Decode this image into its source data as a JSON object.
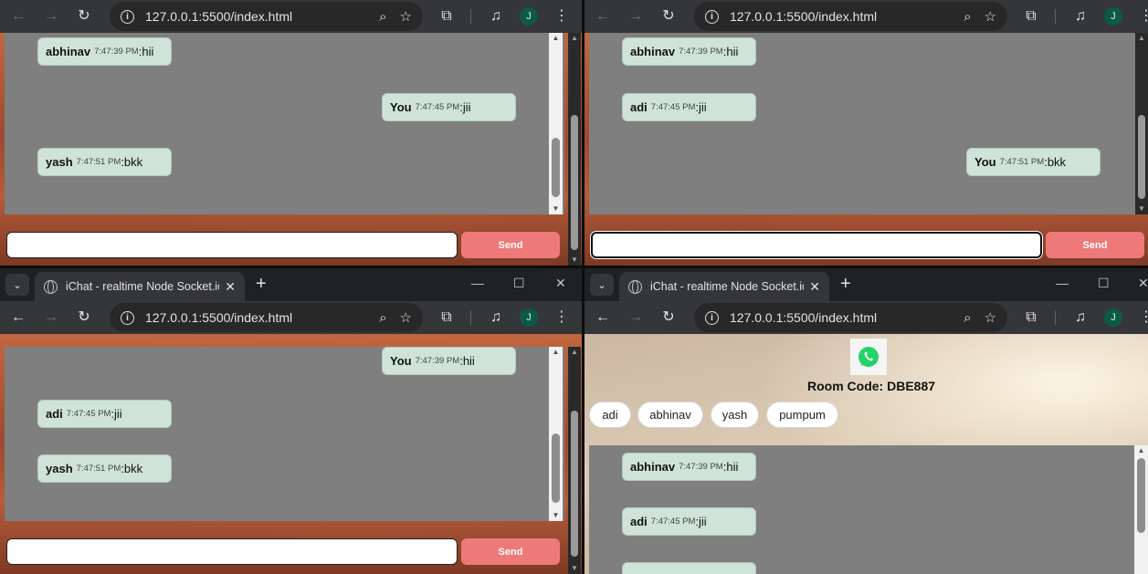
{
  "browser": {
    "url": "127.0.0.1:5500/index.html",
    "tab_title": "iChat - realtime Node Socket.io",
    "profile_initial": "J",
    "new_tab": "+",
    "tab_close": "✕",
    "minimize": "—",
    "maximize": "☐",
    "close": "✕"
  },
  "chat": {
    "send_label": "Send",
    "input_value": "",
    "separator": ": "
  },
  "windows": {
    "w1": {
      "messages": [
        {
          "sender": "abhinav",
          "time": "7:47:39 PM",
          "text": "hii"
        },
        {
          "sender": "You",
          "time": "7:47:45 PM",
          "text": "jii"
        },
        {
          "sender": "yash",
          "time": "7:47:51 PM",
          "text": "bkk"
        }
      ]
    },
    "w2": {
      "messages": [
        {
          "sender": "abhinav",
          "time": "7:47:39 PM",
          "text": "hii"
        },
        {
          "sender": "adi",
          "time": "7:47:45 PM",
          "text": "jii"
        },
        {
          "sender": "You",
          "time": "7:47:51 PM",
          "text": "bkk"
        }
      ]
    },
    "w3": {
      "messages": [
        {
          "sender": "You",
          "time": "7:47:39 PM",
          "text": "hii"
        },
        {
          "sender": "adi",
          "time": "7:47:45 PM",
          "text": "jii"
        },
        {
          "sender": "yash",
          "time": "7:47:51 PM",
          "text": "bkk"
        }
      ]
    },
    "w4": {
      "room_code": "Room Code: DBE887",
      "users": [
        "adi",
        "abhinav",
        "yash",
        "pumpum"
      ],
      "messages": [
        {
          "sender": "abhinav",
          "time": "7:47:39 PM",
          "text": "hii"
        },
        {
          "sender": "adi",
          "time": "7:47:45 PM",
          "text": "jii"
        }
      ]
    }
  },
  "icons": {
    "back": "back-arrow-icon",
    "forward": "forward-arrow-icon",
    "reload": "reload-icon",
    "site_info": "site-info-icon",
    "zoom": "zoom-icon",
    "bookmark": "bookmark-star-icon",
    "extensions": "extensions-puzzle-icon",
    "media": "media-controls-icon",
    "menu": "kebab-menu-icon",
    "logo": "whatsapp-logo-icon"
  }
}
